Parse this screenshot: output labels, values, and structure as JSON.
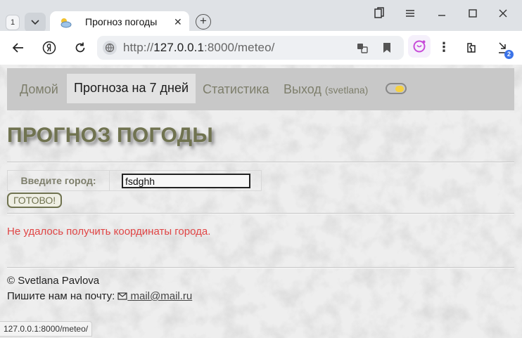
{
  "browser": {
    "tab_count": "1",
    "tab_title": "Прогноз погоды",
    "tab_close": "✕",
    "new_tab": "+",
    "url_prefix": "http://",
    "url_host": "127.0.0.1",
    "url_rest": ":8000/meteo/",
    "downloads_badge": "2",
    "menu_glyph": "⋮"
  },
  "nav": {
    "home": "Домой",
    "forecast": "Прогноза на 7 дней",
    "stats": "Статистика",
    "logout": "Выход",
    "username": "(svetlana)"
  },
  "page": {
    "title": "ПРОГНОЗ ПОГОДЫ",
    "form": {
      "label": "Введите город:",
      "city_value": "fsdghh",
      "submit": "ГОТОВО!"
    },
    "error": "Не удалось получить координаты города."
  },
  "footer": {
    "copyright": "© Svetlana Pavlova",
    "mail_prefix": "Пишите нам на почту:",
    "mail_link": " mail@mail.ru"
  },
  "status_url": "127.0.0.1:8000/meteo/",
  "colors": {
    "accent": "#707350",
    "nav_bg": "#c8c8c8",
    "error": "#e04545"
  }
}
